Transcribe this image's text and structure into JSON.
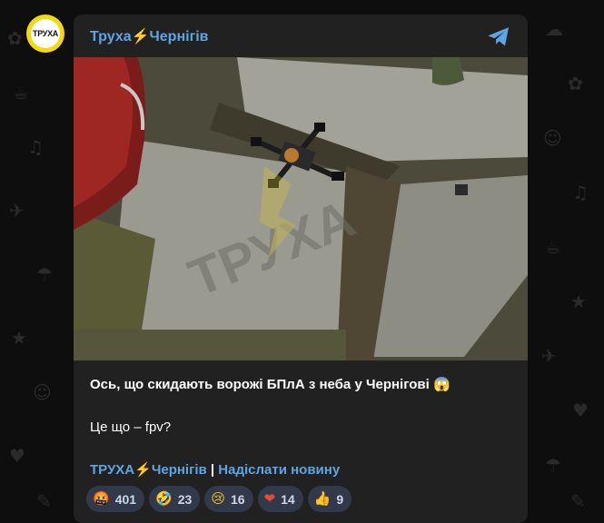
{
  "channel": {
    "avatar_text": "ТРУХА",
    "name": "Труха⚡️Чернігів"
  },
  "post": {
    "caption_line1": "Ось, що скидають ворожі БПлА з неба у Чернігові 😱",
    "caption_line2": "Це що – fpv?",
    "photo_watermark": "ТРУХА",
    "links": {
      "channel_link": "ТРУХА⚡️Чернігів",
      "separator": " | ",
      "send_news_link": "Надіслати новину"
    }
  },
  "reactions": [
    {
      "emoji": "🤬",
      "count": "401",
      "icon": "angry-face-icon"
    },
    {
      "emoji": "🤣",
      "count": "23",
      "icon": "rofl-face-icon"
    },
    {
      "emoji": "😢",
      "count": "16",
      "icon": "crying-face-icon"
    },
    {
      "emoji": "❤",
      "count": "14",
      "icon": "heart-icon"
    },
    {
      "emoji": "👍",
      "count": "9",
      "icon": "thumbs-up-icon"
    }
  ],
  "colors": {
    "background": "#0e0e0e",
    "card": "#212121",
    "link": "#5ea5e3",
    "reaction_bg": "#32394a",
    "avatar_yellow": "#f5d90f"
  }
}
